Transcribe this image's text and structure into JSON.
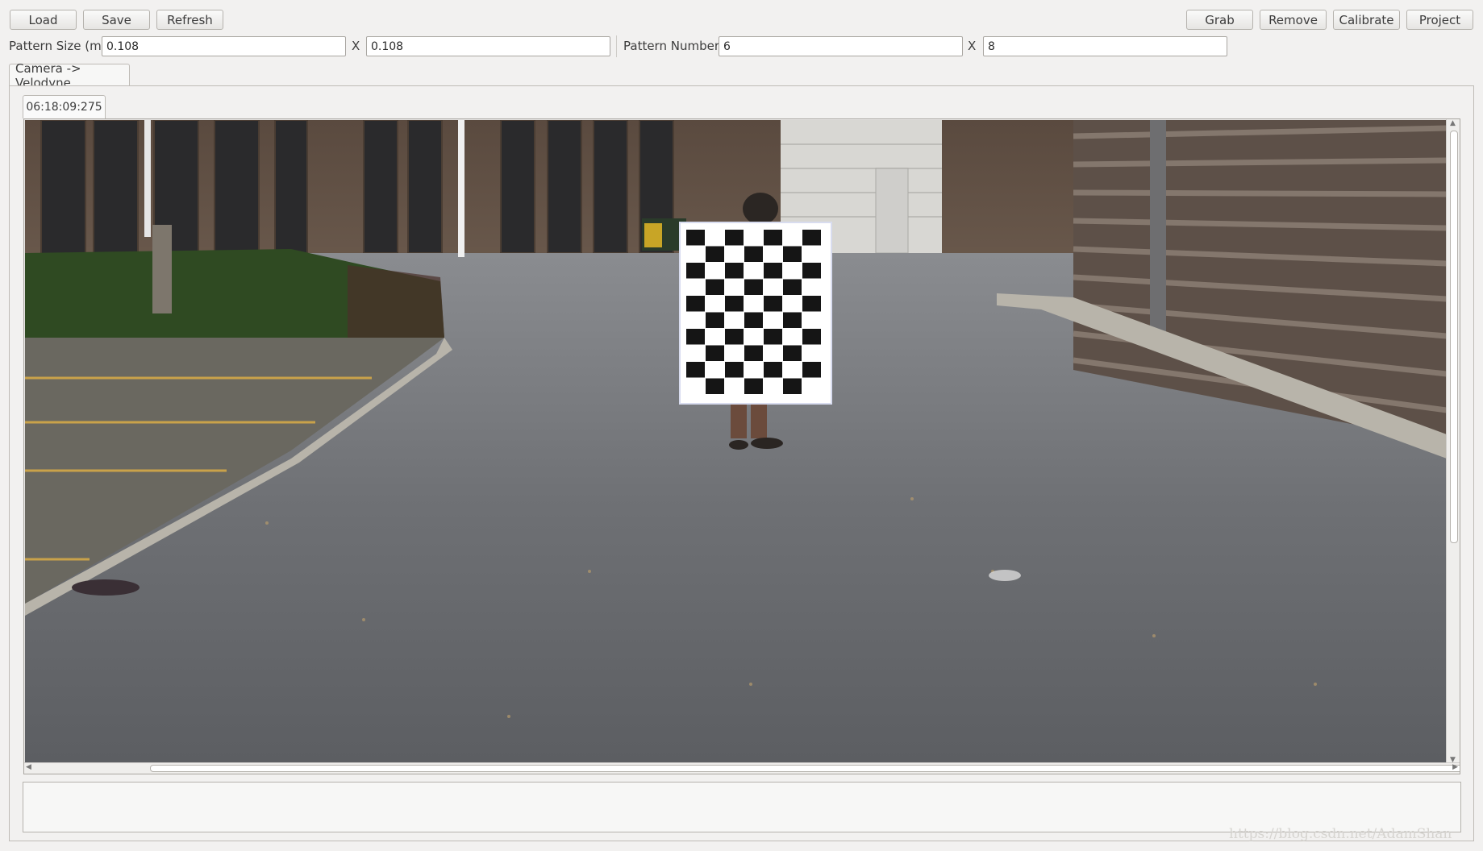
{
  "toolbar": {
    "load_label": "Load",
    "save_label": "Save",
    "refresh_label": "Refresh",
    "grab_label": "Grab",
    "remove_label": "Remove",
    "calibrate_label": "Calibrate",
    "project_label": "Project"
  },
  "pattern": {
    "size_label": "Pattern Size (m)",
    "size_x": "0.108",
    "size_sep": "X",
    "size_y": "0.108",
    "number_label": "Pattern Number",
    "number_x": "6",
    "number_sep": "X",
    "number_y": "8"
  },
  "tabs": {
    "main_tab": "Camera -> Velodyne",
    "frame_tab": "06:18:09:275"
  },
  "image": {
    "description_icon": "camera-frame-checkerboard",
    "board_rows": 10,
    "board_cols": 7
  },
  "watermark": "https://blog.csdn.net/AdamShan",
  "colors": {
    "window_bg": "#f2f1f0",
    "board_dark": "#151515"
  }
}
